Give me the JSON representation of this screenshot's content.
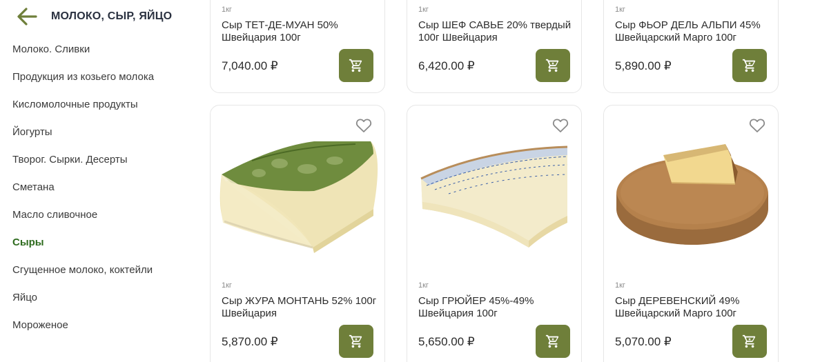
{
  "sidebar": {
    "title": "МОЛОКО, СЫР, ЯЙЦО",
    "items": [
      {
        "label": "Молоко. Сливки"
      },
      {
        "label": "Продукция из козьего молока"
      },
      {
        "label": "Кисломолочные продукты"
      },
      {
        "label": "Йогурты"
      },
      {
        "label": "Творог. Сырки. Десерты"
      },
      {
        "label": "Сметана"
      },
      {
        "label": "Масло сливочное"
      },
      {
        "label": "Сыры"
      },
      {
        "label": "Сгущенное молоко, коктейли"
      },
      {
        "label": "Яйцо"
      },
      {
        "label": "Мороженое"
      }
    ],
    "active_item": "Сыры"
  },
  "products": [
    {
      "weight": "1кг",
      "name": "Сыр ТЕТ-ДЕ-МУАН 50% Швейцария 100г",
      "price": "7,040.00 ₽"
    },
    {
      "weight": "1кг",
      "name": "Сыр ШЕФ САВЬЕ 20% твердый 100г Швейцария",
      "price": "6,420.00 ₽"
    },
    {
      "weight": "1кг",
      "name": "Сыр ФЬОР ДЕЛЬ АЛЬПИ 45% Швейцарский Марго 100г",
      "price": "5,890.00 ₽"
    },
    {
      "weight": "1кг",
      "name": "Сыр ЖУРА МОНТАНЬ 52% 100г Швейцария",
      "price": "5,870.00 ₽"
    },
    {
      "weight": "1кг",
      "name": "Сыр ГРЮЙЕР 45%-49% Швейцария 100г",
      "price": "5,650.00 ₽"
    },
    {
      "weight": "1кг",
      "name": "Сыр ДЕРЕВЕНСКИЙ 49% Швейцарский Марго 100г",
      "price": "5,070.00 ₽"
    }
  ],
  "colors": {
    "accent": "#6f7f3a",
    "active_category": "#2e6b1e",
    "back_arrow": "#6f7f3a"
  },
  "icons": {
    "back": "arrow-left-icon",
    "favorite": "heart-outline-icon",
    "cart": "cart-icon"
  }
}
